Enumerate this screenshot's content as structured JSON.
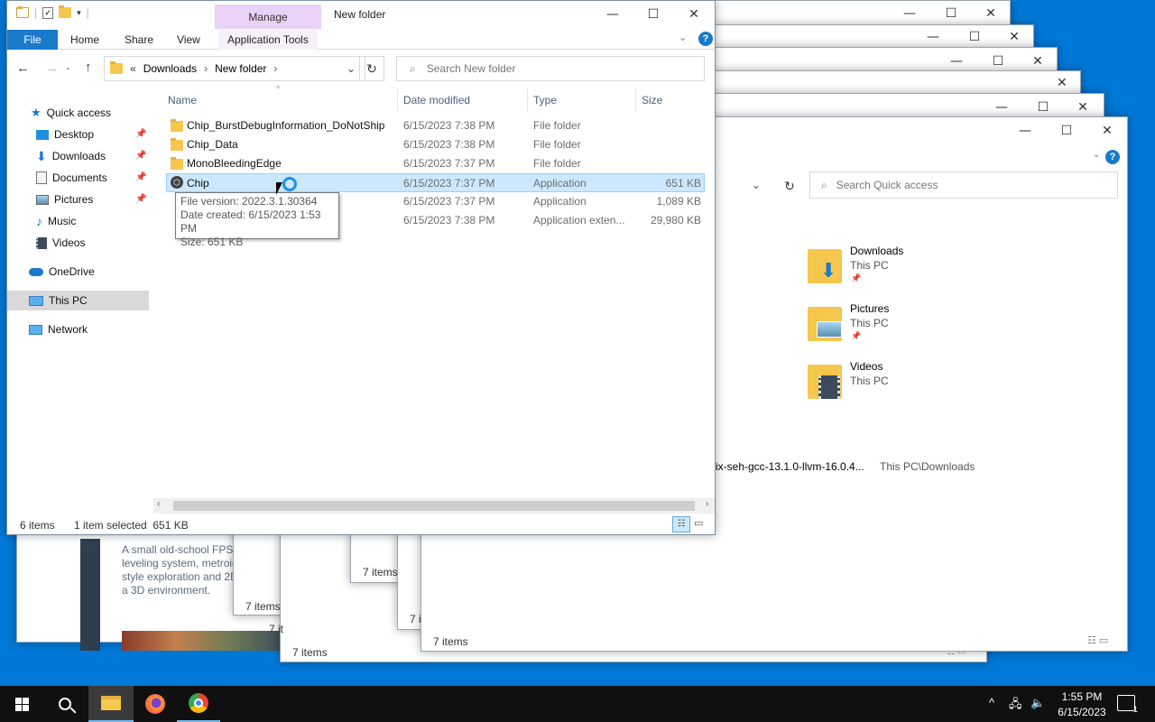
{
  "main_window": {
    "title": "New folder",
    "manage_label": "Manage",
    "tabs": [
      "File",
      "Home",
      "Share",
      "View",
      "Application Tools"
    ],
    "breadcrumb": {
      "prefix": "«",
      "parts": [
        "Downloads",
        "New folder"
      ]
    },
    "search_placeholder": "Search New folder",
    "nav": {
      "quick_access": "Quick access",
      "items": [
        "Desktop",
        "Downloads",
        "Documents",
        "Pictures",
        "Music",
        "Videos"
      ],
      "onedrive": "OneDrive",
      "this_pc": "This PC",
      "network": "Network"
    },
    "columns": [
      "Name",
      "Date modified",
      "Type",
      "Size"
    ],
    "files": [
      {
        "name": "Chip_BurstDebugInformation_DoNotShip",
        "date": "6/15/2023 7:38 PM",
        "type": "File folder",
        "size": ""
      },
      {
        "name": "Chip_Data",
        "date": "6/15/2023 7:38 PM",
        "type": "File folder",
        "size": ""
      },
      {
        "name": "MonoBleedingEdge",
        "date": "6/15/2023 7:37 PM",
        "type": "File folder",
        "size": ""
      },
      {
        "name": "Chip",
        "date": "6/15/2023 7:37 PM",
        "type": "Application",
        "size": "651 KB"
      },
      {
        "name": "",
        "date": "6/15/2023 7:37 PM",
        "type": "Application",
        "size": "1,089 KB"
      },
      {
        "name": "",
        "date": "6/15/2023 7:38 PM",
        "type": "Application exten...",
        "size": "29,980 KB"
      }
    ],
    "tooltip": {
      "version": "File version: 2022.3.1.30364",
      "created": "Date created: 6/15/2023 1:53 PM",
      "size": "Size: 651 KB"
    },
    "status": {
      "count": "6 items",
      "selection": "1 item selected  651 KB"
    }
  },
  "back_window": {
    "search_placeholder": "Search Quick access",
    "quick_items": [
      {
        "name": "Downloads",
        "sub": "This PC"
      },
      {
        "name": "Pictures",
        "sub": "This PC"
      },
      {
        "name": "Videos",
        "sub": "This PC"
      }
    ],
    "recent_file": "ix-seh-gcc-13.1.0-llvm-16.0.4...",
    "recent_path": "This PC\\Downloads",
    "status": "7 items"
  },
  "other_windows": {
    "status_a": "7 items",
    "status_b": "7 items",
    "status_c": "7 items",
    "status_d": "7 it",
    "status_e": "7 i"
  },
  "store_page": {
    "desc": [
      "A small old-school FPS f",
      "leveling system, metroic",
      "style exploration and 2D",
      "a 3D environment."
    ]
  },
  "taskbar": {
    "time": "1:55 PM",
    "date": "6/15/2023",
    "notifications": "1"
  }
}
